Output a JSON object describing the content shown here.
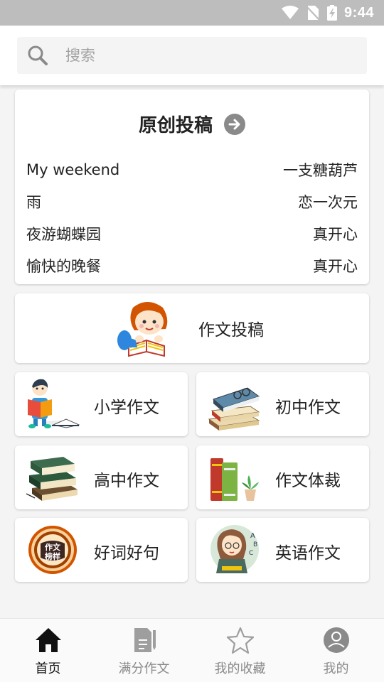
{
  "status_bar": {
    "time": "9:44"
  },
  "search": {
    "placeholder": "搜索"
  },
  "featured": {
    "title": "原创投稿",
    "posts": [
      {
        "title": "My weekend",
        "author": "一支糖葫芦"
      },
      {
        "title": "雨",
        "author": "恋一次元"
      },
      {
        "title": "夜游蝴蝶园",
        "author": "真开心"
      },
      {
        "title": "愉快的晚餐",
        "author": "真开心"
      }
    ]
  },
  "submit": {
    "label": "作文投稿"
  },
  "categories": [
    {
      "label": "小学作文",
      "icon": "student-reading-icon"
    },
    {
      "label": "初中作文",
      "icon": "book-stack-glasses-icon"
    },
    {
      "label": "高中作文",
      "icon": "green-books-icon"
    },
    {
      "label": "作文体裁",
      "icon": "books-plant-icon"
    },
    {
      "label": "好词好句",
      "icon": "badge-emblem-icon"
    },
    {
      "label": "英语作文",
      "icon": "girl-abc-icon"
    }
  ],
  "badge_text": "作文榜样",
  "bottom_nav": [
    {
      "label": "首页",
      "icon": "home-icon",
      "active": true
    },
    {
      "label": "满分作文",
      "icon": "document-pen-icon",
      "active": false
    },
    {
      "label": "我的收藏",
      "icon": "star-icon",
      "active": false
    },
    {
      "label": "我的",
      "icon": "user-icon",
      "active": false
    }
  ],
  "colors": {
    "accent_text": "#222222",
    "inactive": "#8a8a8a",
    "status_bar": "#bdbdbd"
  }
}
